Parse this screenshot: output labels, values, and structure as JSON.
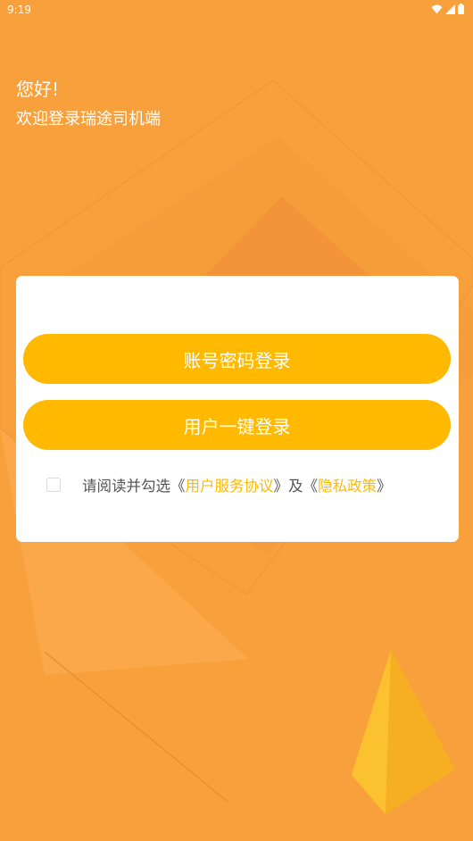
{
  "colors": {
    "background": "#F8A13C",
    "accent": "#FFB901",
    "card": "#ffffff",
    "text_muted": "#555555"
  },
  "status_bar": {
    "time": "9:19",
    "icons": [
      "wifi-icon",
      "signal-icon",
      "battery-icon"
    ]
  },
  "greeting": {
    "line1": "您好!",
    "line2": "欢迎登录瑞途司机端"
  },
  "login": {
    "password_login_label": "账号密码登录",
    "one_click_login_label": "用户一键登录"
  },
  "agreement": {
    "checked": false,
    "prefix": "请阅读并勾选",
    "open_bracket_1": "《",
    "service_link": "用户服务协议",
    "close_bracket_1": "》",
    "and_text": "及",
    "open_bracket_2": "《",
    "privacy_link": "隐私政策",
    "close_bracket_2": "》"
  }
}
